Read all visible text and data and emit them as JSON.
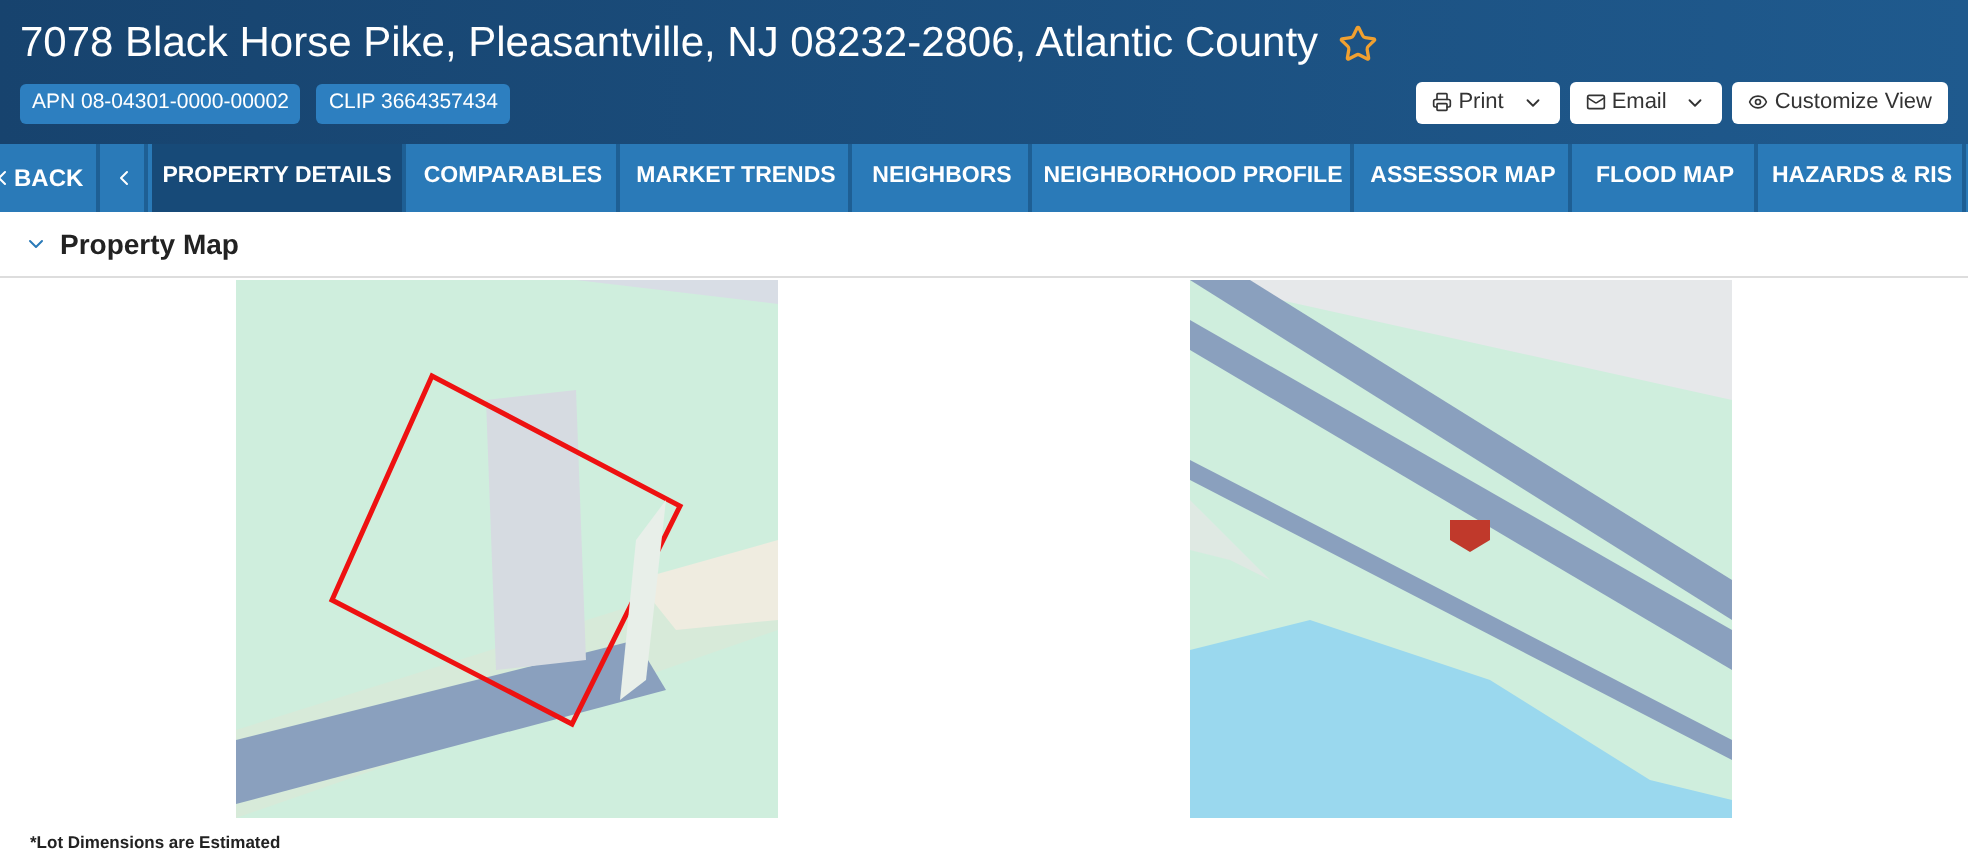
{
  "header": {
    "title": "7078 Black Horse Pike, Pleasantville, NJ 08232-2806, Atlantic County",
    "favorite": false,
    "badges": [
      "APN 08-04301-0000-00002",
      "CLIP 3664357434"
    ],
    "actions": [
      {
        "label": "Print",
        "kind": "print"
      },
      {
        "label": "Email",
        "kind": "email"
      },
      {
        "label": "Customize View",
        "kind": "view"
      }
    ]
  },
  "nav": {
    "back": "BACK",
    "tabs": [
      {
        "label": "PROPERTY DETAILS",
        "selected": true
      },
      {
        "label": "COMPARABLES",
        "selected": false
      },
      {
        "label": "MARKET TRENDS",
        "selected": false
      },
      {
        "label": "NEIGHBORS",
        "selected": false
      },
      {
        "label": "NEIGHBORHOOD PROFILE",
        "selected": false
      },
      {
        "label": "ASSESSOR MAP",
        "selected": false
      },
      {
        "label": "FLOOD MAP",
        "selected": false
      },
      {
        "label": "HAZARDS & RIS",
        "selected": false
      }
    ]
  },
  "section": {
    "title": "Property Map",
    "expanded": true,
    "note": "*Lot Dimensions are Estimated"
  }
}
